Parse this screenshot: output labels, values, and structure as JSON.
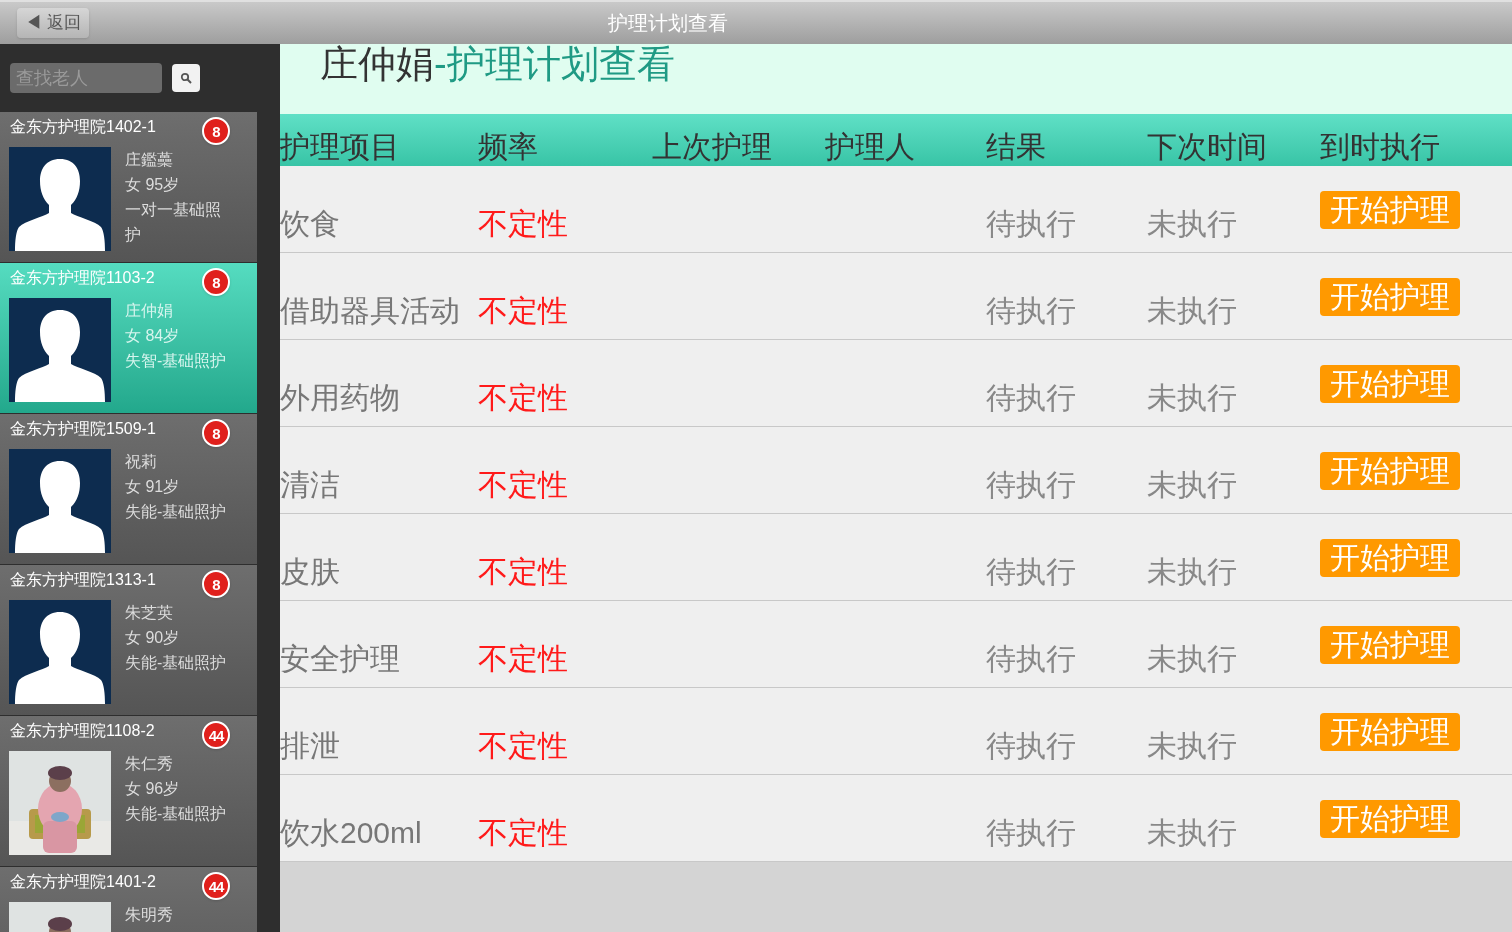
{
  "top_bar": {
    "back_button": "◀ 返回",
    "title": "护理计划查看"
  },
  "search": {
    "placeholder": "查找老人"
  },
  "residents": [
    {
      "room": "金东方护理院1402-1",
      "count": "8",
      "kind": "silhouette",
      "selected": false,
      "lines": [
        "庄鑑蘽",
        "女 95岁",
        "一对一基础照护"
      ]
    },
    {
      "room": "金东方护理院1103-2",
      "count": "8",
      "kind": "silhouette",
      "selected": true,
      "lines": [
        "庄仲娟",
        "女 84岁",
        "失智-基础照护"
      ]
    },
    {
      "room": "金东方护理院1509-1",
      "count": "8",
      "kind": "silhouette",
      "selected": false,
      "lines": [
        "祝莉",
        "女 91岁",
        "失能-基础照护"
      ]
    },
    {
      "room": "金东方护理院1313-1",
      "count": "8",
      "kind": "silhouette",
      "selected": false,
      "lines": [
        "朱芝英",
        "女 90岁",
        "失能-基础照护"
      ]
    },
    {
      "room": "金东方护理院1108-2",
      "count": "44",
      "kind": "picture",
      "selected": false,
      "lines": [
        "朱仁秀",
        "女 96岁",
        "失能-基础照护"
      ]
    },
    {
      "room": "金东方护理院1401-2",
      "count": "44",
      "kind": "picture",
      "selected": false,
      "lines": [
        "朱明秀"
      ]
    }
  ],
  "heading": {
    "name": "庄仲娟",
    "suffix": "-护理计划查看"
  },
  "table": {
    "columns": [
      "护理项目",
      "频率",
      "上次护理",
      "护理人",
      "结果",
      "下次时间",
      "到时执行"
    ],
    "rows": [
      {
        "item": "饮食",
        "frequency": "不定性",
        "result": "待执行",
        "next": "未执行",
        "action": "开始护理"
      },
      {
        "item": "借助器具活动",
        "frequency": "不定性",
        "result": "待执行",
        "next": "未执行",
        "action": "开始护理"
      },
      {
        "item": "外用药物",
        "frequency": "不定性",
        "result": "待执行",
        "next": "未执行",
        "action": "开始护理"
      },
      {
        "item": "清洁",
        "frequency": "不定性",
        "result": "待执行",
        "next": "未执行",
        "action": "开始护理"
      },
      {
        "item": "皮肤",
        "frequency": "不定性",
        "result": "待执行",
        "next": "未执行",
        "action": "开始护理"
      },
      {
        "item": "安全护理",
        "frequency": "不定性",
        "result": "待执行",
        "next": "未执行",
        "action": "开始护理"
      },
      {
        "item": "排泄",
        "frequency": "不定性",
        "result": "待执行",
        "next": "未执行",
        "action": "开始护理"
      },
      {
        "item": "饮水200ml",
        "frequency": "不定性",
        "result": "待执行",
        "next": "未执行",
        "action": "开始护理"
      }
    ]
  }
}
